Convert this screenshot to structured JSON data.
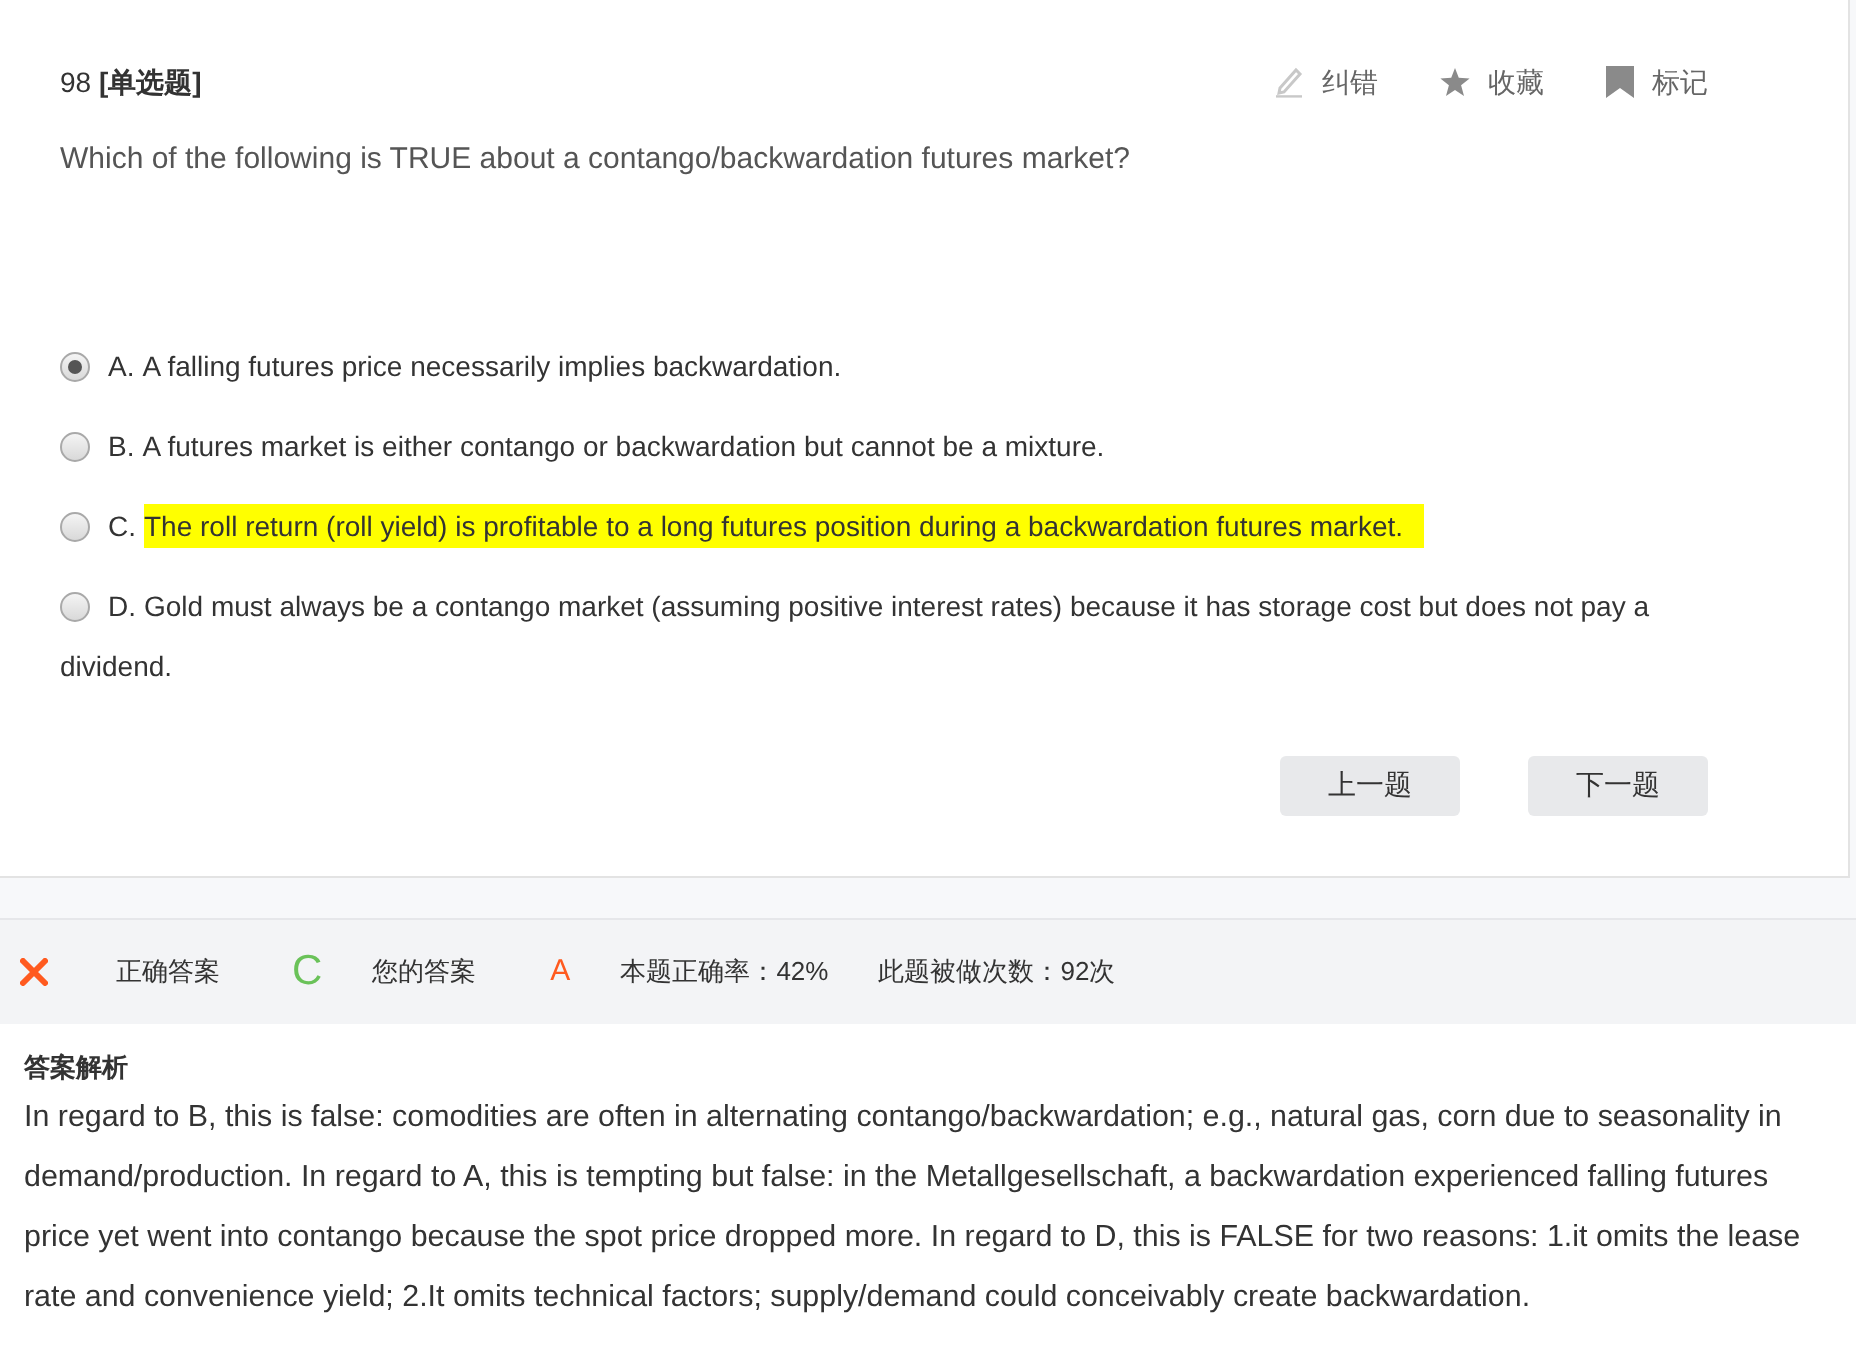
{
  "header": {
    "title": "98 **[单选题]**",
    "actions": [
      {
        "kind": "correct",
        "label": "纠错"
      },
      {
        "kind": "favorite",
        "label": "收藏"
      },
      {
        "kind": "mark",
        "label": "标记"
      }
    ]
  },
  "question": "Which of the following is TRUE about a contango/backwardation futures market?",
  "options": [
    {
      "letter": "A.",
      "text": "A falling futures price necessarily implies backwardation.",
      "selected": true,
      "highlighted": false
    },
    {
      "letter": "B.",
      "text": "A futures market is either contango or backwardation but cannot be a mixture.",
      "selected": false,
      "highlighted": false
    },
    {
      "letter": "C.",
      "text": "The roll return (roll yield) is profitable to a long futures position during a backwardation futures market.",
      "selected": false,
      "highlighted": true
    },
    {
      "letter": "D.",
      "text": "Gold must always be a contango market (assuming positive interest rates) because it has storage cost but does not pay a dividend.",
      "selected": false,
      "highlighted": false
    }
  ],
  "buttons": [
    "上一题",
    "下一题"
  ],
  "result": {
    "wrong": true,
    "correct_label": "正确答案",
    "correct_value": "C",
    "your_label": "您的答案",
    "your_value": "A",
    "accuracy": "本题正确率：42%",
    "attempts": "此题被做次数：92次"
  },
  "analysis": {
    "title": "答案解析",
    "text": "In regard to B, this is false: comodities are often in alternating contango/backwardation; e.g., natural gas, corn due to seasonality in demand/production. In regard to A, this is tempting but false: in the Metallgesellschaft, a backwardation experienced falling futures price yet went into contango because the spot price dropped more. In regard to D, this is FALSE for two reasons: 1.it omits the lease rate and convenience yield; 2.It omits technical factors; supply/demand could conceivably create backwardation."
  }
}
